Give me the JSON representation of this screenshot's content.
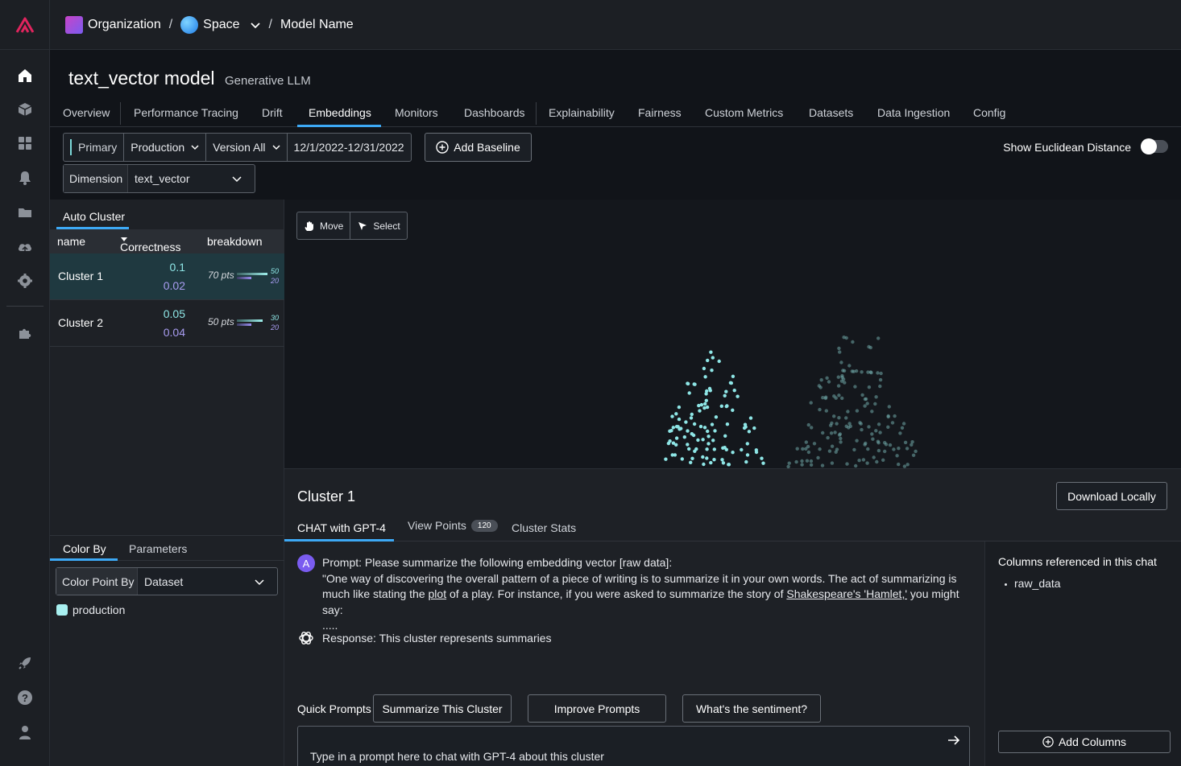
{
  "breadcrumb": {
    "organization": "Organization",
    "space": "Space",
    "model": "Model Name"
  },
  "header": {
    "title": "text_vector model",
    "subtitle": "Generative LLM"
  },
  "tabs": [
    "Overview",
    "Performance Tracing",
    "Drift",
    "Embeddings",
    "Monitors",
    "Dashboards",
    "Explainability",
    "Fairness",
    "Custom Metrics",
    "Datasets",
    "Data Ingestion",
    "Config"
  ],
  "active_tab": "Embeddings",
  "filters": {
    "primary": "Primary",
    "environment": "Production",
    "version": "Version All",
    "date_range": "12/1/2022-12/31/2022",
    "add_baseline": "Add Baseline",
    "dimension_label": "Dimension",
    "dimension_value": "text_vector"
  },
  "toggle": {
    "label": "Show Euclidean Distance",
    "on": false
  },
  "auto_cluster": {
    "title": "Auto Cluster",
    "columns": [
      "name",
      "Correctness",
      "breakdown"
    ],
    "rows": [
      {
        "name": "Cluster 1",
        "v1": "0.1",
        "v2": "0.02",
        "pts": "70 pts",
        "n1": "50",
        "n2": "20"
      },
      {
        "name": "Cluster 2",
        "v1": "0.05",
        "v2": "0.04",
        "pts": "50 pts",
        "n1": "30",
        "n2": "20"
      }
    ]
  },
  "color_by": {
    "tabs": [
      "Color By",
      "Parameters"
    ],
    "label": "Color Point By",
    "value": "Dataset",
    "legend": "production"
  },
  "plot_tools": {
    "move": "Move",
    "select": "Select"
  },
  "cluster_panel": {
    "title": "Cluster 1",
    "download": "Download Locally",
    "tabs": {
      "chat": "CHAT with GPT-4",
      "view_points": "View Points",
      "view_points_count": "120",
      "stats": "Cluster Stats"
    },
    "avatar": "A",
    "prompt_line1": "Prompt: Please summarize the following embedding vector [raw data]:",
    "prompt_part1": "\"One way of discovering the overall pattern of a piece of writing is to summarize it in your own words. The act of summarizing is much like stating the ",
    "prompt_link1": "plot",
    "prompt_part2": " of a play. For instance, if you were asked to summarize the story of ",
    "prompt_link2": "Shakespeare's 'Hamlet,'",
    "prompt_part3": " you might say:",
    "prompt_ellipsis": ".....",
    "response": "Response: This cluster represents summaries",
    "quick_prompts_label": "Quick Prompts",
    "quick_prompts": [
      "Summarize This Cluster",
      "Improve Prompts",
      "What's the sentiment?"
    ],
    "input_placeholder": "Type in a prompt here to chat with GPT-4 about this cluster",
    "columns_title": "Columns referenced in this chat",
    "columns": [
      "raw_data"
    ],
    "add_columns": "Add Columns"
  },
  "colors": {
    "accent": "#3da9f5",
    "cluster_primary": "#8ee6e6",
    "cluster_secondary": "#6fa8a8"
  }
}
